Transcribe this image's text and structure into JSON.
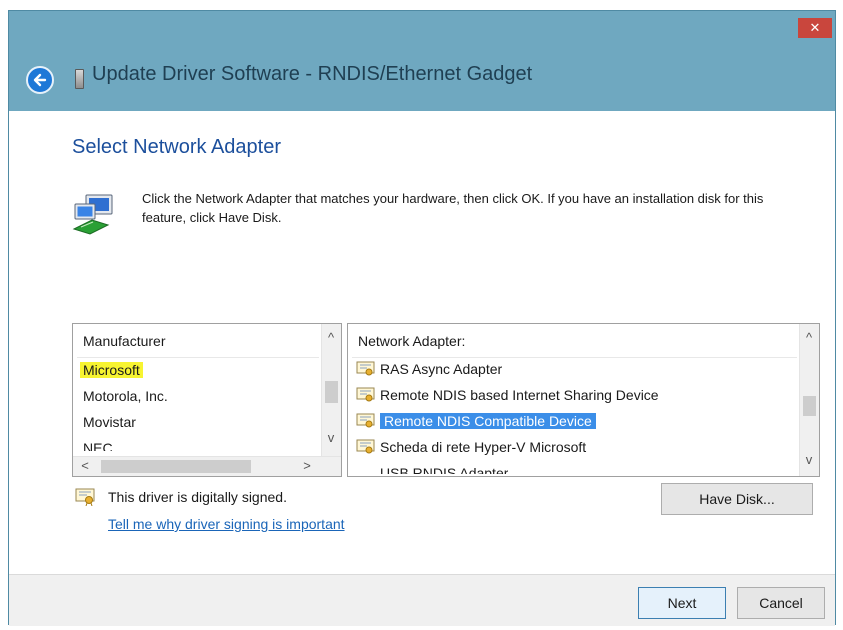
{
  "window": {
    "title": "Update Driver Software - RNDIS/Ethernet Gadget",
    "close_symbol": "✕"
  },
  "heading": "Select Network Adapter",
  "instruction": "Click the Network Adapter that matches your hardware, then click OK. If you have an installation disk for this feature, click Have Disk.",
  "manufacturer_list": {
    "header": "Manufacturer",
    "items": [
      "Microsoft",
      "Motorola, Inc.",
      "Movistar",
      "NEC"
    ],
    "selected": "Microsoft"
  },
  "adapter_list": {
    "header": "Network Adapter:",
    "items": [
      "RAS Async Adapter",
      "Remote NDIS based Internet Sharing Device",
      "Remote NDIS Compatible Device",
      "Scheda di rete Hyper-V Microsoft",
      "USB RNDIS Adapter"
    ],
    "selected": "Remote NDIS Compatible Device"
  },
  "signature": {
    "status": "This driver is digitally signed.",
    "link": "Tell me why driver signing is important"
  },
  "buttons": {
    "have_disk": "Have Disk...",
    "next": "Next",
    "cancel": "Cancel"
  },
  "scroll_symbols": {
    "up": "^",
    "down": "v",
    "left": "<",
    "right": ">"
  },
  "colors": {
    "title_bar": "#6fa8c0",
    "heading": "#1c4f9c",
    "selection_blue": "#3b8ee8",
    "highlight_yellow": "#f7f431",
    "link": "#1a65b8",
    "close_button": "#c9463d"
  }
}
